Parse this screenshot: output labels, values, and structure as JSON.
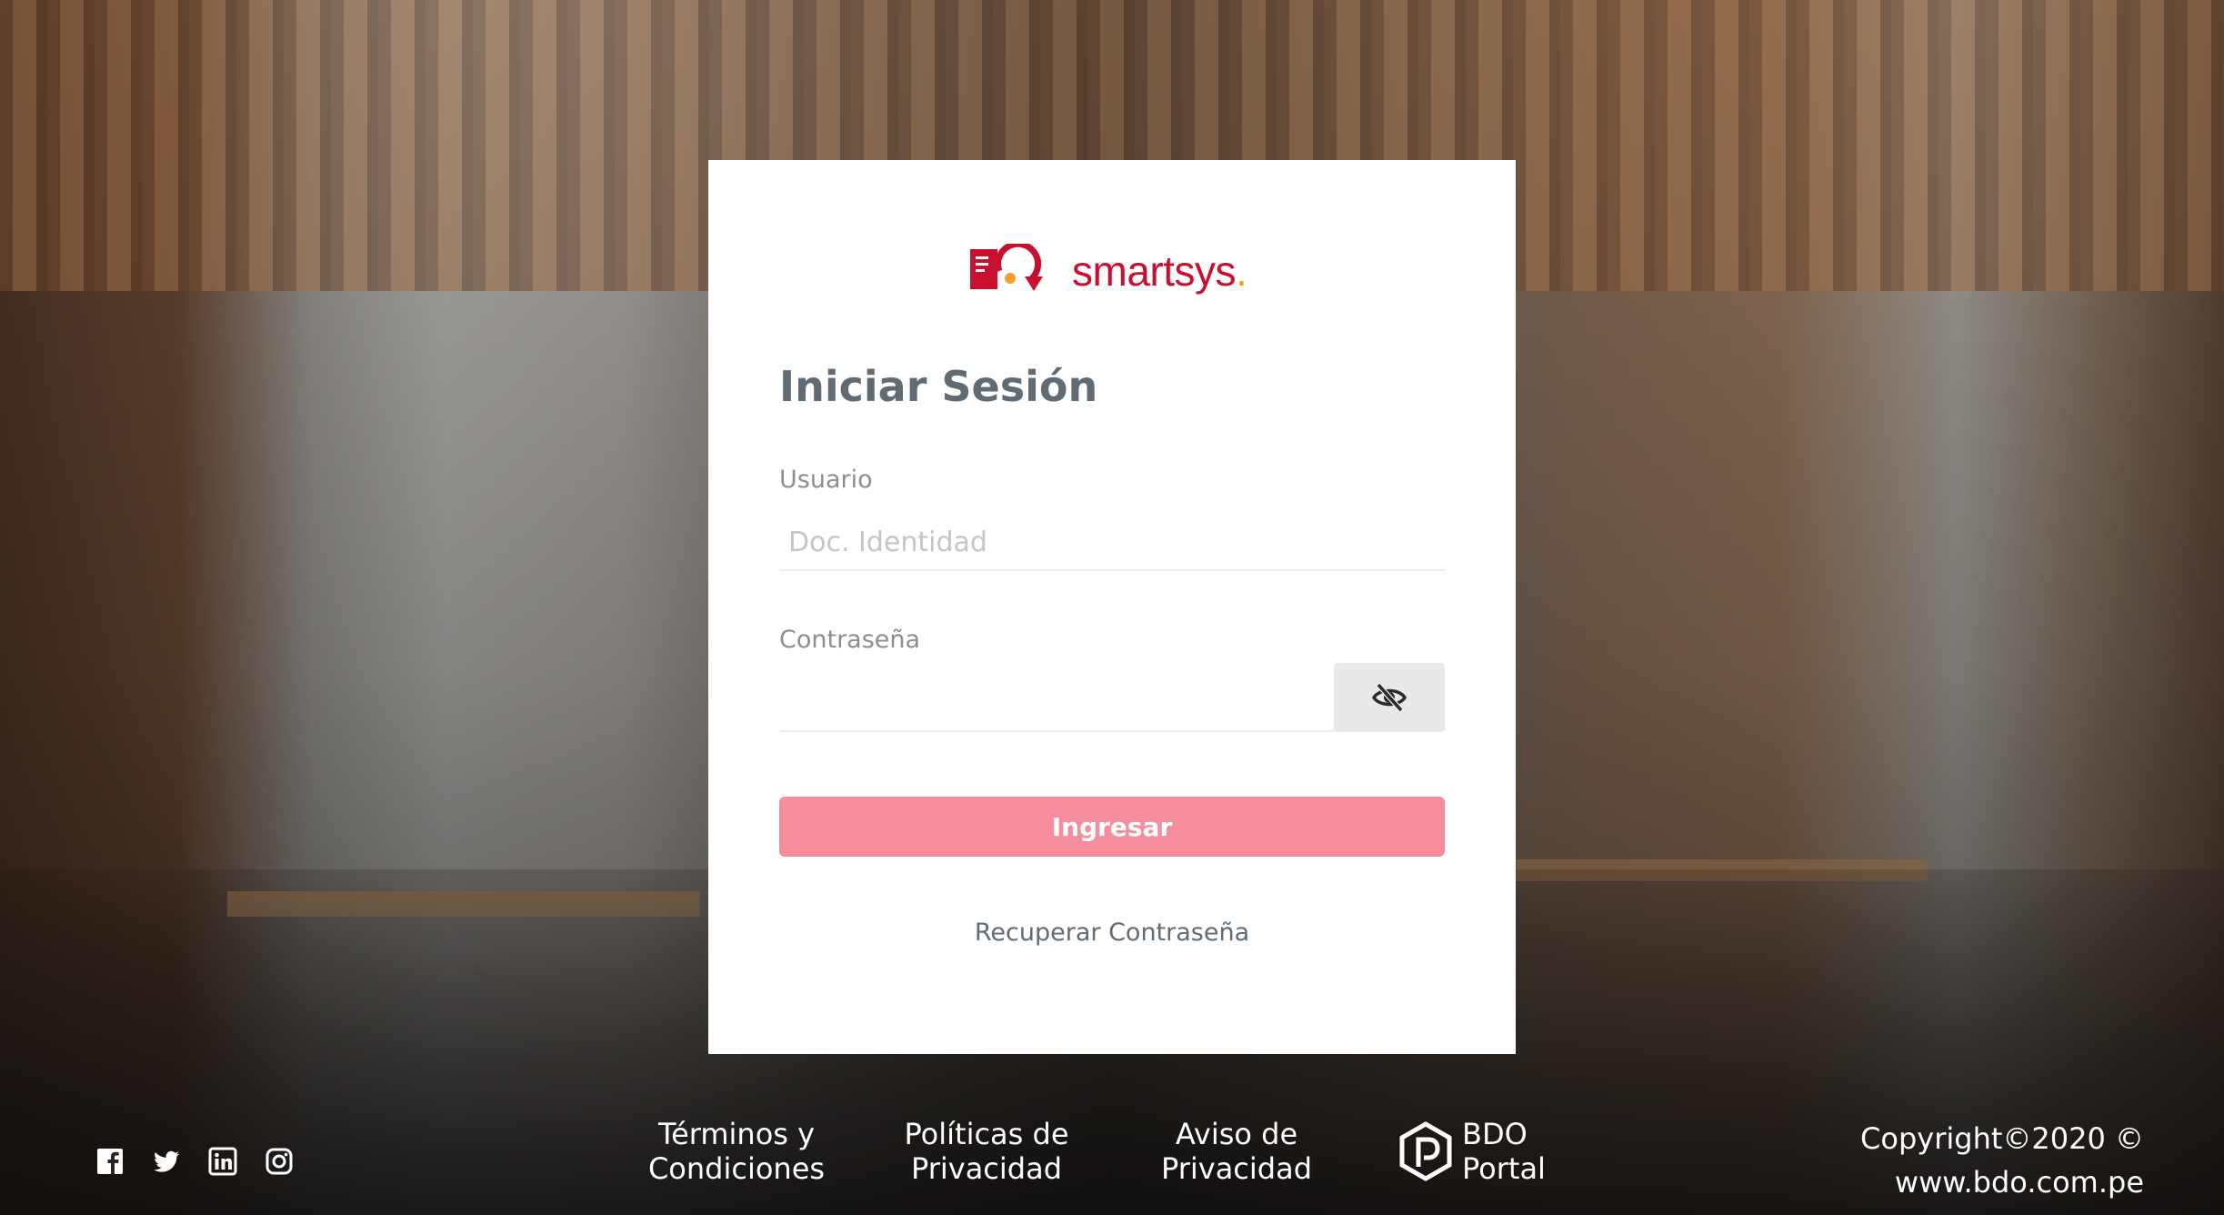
{
  "brand": {
    "name_part1": "smart",
    "name_part2": "sys",
    "name_dot": ".",
    "colors": {
      "primary": "#c8102e",
      "accent": "#f59e2a"
    }
  },
  "login": {
    "title": "Iniciar Sesión",
    "user_label": "Usuario",
    "user_placeholder": "Doc. Identidad",
    "user_value": "",
    "password_label": "Contraseña",
    "password_value": "",
    "toggle_icon": "eye-slash-icon",
    "submit_label": "Ingresar",
    "recover_label": "Recuperar Contraseña",
    "submit_color": "#f58d9c"
  },
  "footer": {
    "social_icons": [
      "facebook-icon",
      "twitter-icon",
      "linkedin-icon",
      "instagram-icon"
    ],
    "terms_line1": "Términos y",
    "terms_line2": "Condiciones",
    "policy_line1": "Políticas de",
    "policy_line2": "Privacidad",
    "notice_line1": "Aviso de",
    "notice_line2": "Privacidad",
    "portal_line1": "BDO",
    "portal_line2": "Portal",
    "copyright_line1": "Copyright©2020 ©",
    "copyright_line2": "www.bdo.com.pe"
  }
}
